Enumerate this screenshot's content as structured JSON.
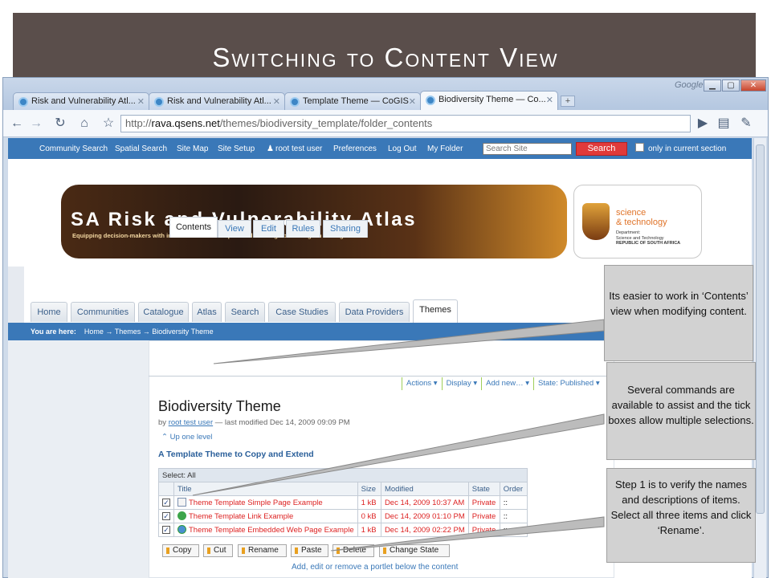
{
  "slide": {
    "title": "Switching to Content View"
  },
  "browser": {
    "tabs": [
      {
        "label": "Risk and Vulnerability Atl..."
      },
      {
        "label": "Risk and Vulnerability Atl..."
      },
      {
        "label": "Template Theme — CoGIS"
      },
      {
        "label": "Biodiversity Theme — Co..."
      }
    ],
    "google_label": "Google",
    "url_prefix": "http://",
    "url_host": "rava.qsens.net",
    "url_path": "/themes/biodiversity_template/folder_contents"
  },
  "site_nav": {
    "links": [
      "Community Search",
      "Spatial Search",
      "Site Map",
      "Site Setup",
      "root test user",
      "Preferences",
      "Log Out",
      "My Folder"
    ],
    "search_placeholder": "Search Site",
    "search_button": "Search",
    "only_current_section": "only in current section"
  },
  "banner": {
    "title": "SA Risk and Vulnerability Atlas",
    "subtitle": "Equipping decision-makers with information on the impact and risk of global change in the region"
  },
  "dst_logo": {
    "line1": "science",
    "line2": "& technology",
    "dept1": "Department:",
    "dept2": "Science and Technology",
    "dept3": "REPUBLIC OF SOUTH AFRICA"
  },
  "portal_tabs": [
    "Home",
    "Communities",
    "Catalogue",
    "Atlas",
    "Search",
    "Case Studies",
    "Data Providers",
    "Themes"
  ],
  "breadcrumb": {
    "label": "You are here:",
    "path": "Home → Themes → Biodiversity Theme"
  },
  "content_tabs": [
    "Contents",
    "View",
    "Edit",
    "Rules",
    "Sharing"
  ],
  "actions": [
    "Actions ▾",
    "Display ▾",
    "Add new… ▾",
    "State: Published ▾"
  ],
  "page": {
    "heading": "Biodiversity Theme",
    "by": "by",
    "author": "root test user",
    "modified": "— last modified Dec 14, 2009 09:09 PM",
    "up_one_level": "Up one level",
    "folder_description": "A Template Theme to Copy and Extend"
  },
  "table": {
    "select_label": "Select: All",
    "headers": [
      "Title",
      "Size",
      "Modified",
      "State",
      "Order"
    ],
    "rows": [
      {
        "title": "Theme Template Simple Page Example",
        "size": "1 kB",
        "modified": "Dec 14, 2009 10:37 AM",
        "state": "Private",
        "order": "::"
      },
      {
        "title": "Theme Template Link Example",
        "size": "0 kB",
        "modified": "Dec 14, 2009 01:10 PM",
        "state": "Private",
        "order": "::"
      },
      {
        "title": "Theme Template Embedded Web Page Example",
        "size": "1 kB",
        "modified": "Dec 14, 2009 02:22 PM",
        "state": "Private",
        "order": "::"
      }
    ]
  },
  "commands": [
    "Copy",
    "Cut",
    "Rename",
    "Paste",
    "Delete",
    "Change State"
  ],
  "portlet_link": "Add, edit or remove a portlet below the content",
  "callouts": [
    "Its easier to work in ‘Contents’ view when modifying content.",
    "Several commands are available to assist and the tick boxes allow multiple selections.",
    "Step 1 is to verify the names and descriptions of items. Select all three items and click ‘Rename’."
  ],
  "colors": {
    "title_bar": "#5a4e4b",
    "site_nav": "#3a78b8",
    "search_button": "#e03a3a",
    "callout_bg": "#d2d2d2"
  }
}
